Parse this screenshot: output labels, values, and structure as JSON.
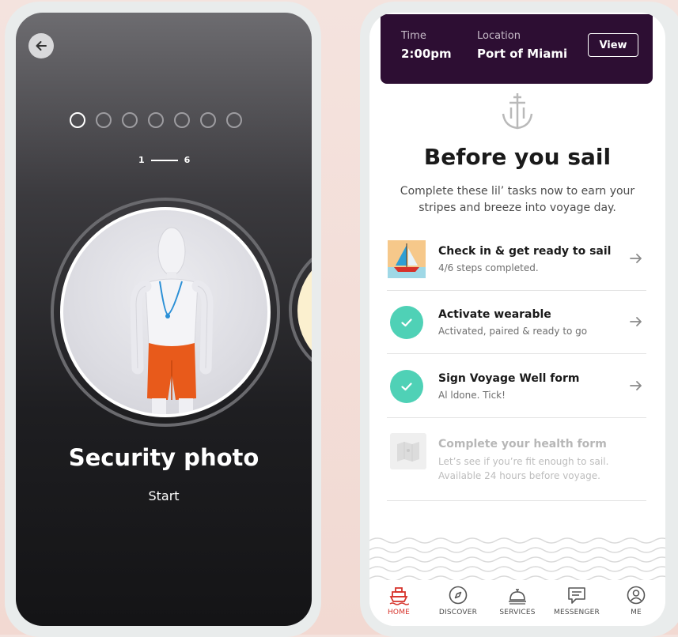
{
  "left_screen": {
    "progress": {
      "current": "1",
      "total": "6",
      "dot_count": 7,
      "active_index": 0
    },
    "card": {
      "title": "Security photo",
      "action": "Start"
    }
  },
  "right_screen": {
    "header": {
      "time_label": "Time",
      "time_value": "2:00pm",
      "location_label": "Location",
      "location_value": "Port of Miami",
      "view_button": "View"
    },
    "title": "Before you sail",
    "subtitle_line1": "Complete these lil’ tasks now to earn your",
    "subtitle_line2": "stripes and breeze into voyage day.",
    "tasks": [
      {
        "title": "Check in & get ready to sail",
        "subtitle": "4/6 steps completed.",
        "icon": "sailboat-icon",
        "state": "in-progress"
      },
      {
        "title": "Activate wearable",
        "subtitle": "Activated, paired & ready to go",
        "icon": "check-icon",
        "state": "done"
      },
      {
        "title": "Sign Voyage Well form",
        "subtitle": "Al ldone. Tick!",
        "icon": "check-icon",
        "state": "done"
      },
      {
        "title": "Complete your health form",
        "subtitle_line1": "Let’s see if you’re fit enough to sail.",
        "subtitle_line2": "Available 24 hours before voyage.",
        "icon": "map-icon",
        "state": "disabled"
      }
    ],
    "nav": {
      "home": "HOME",
      "discover": "DISCOVER",
      "services": "SERVICES",
      "messenger": "MESSENGER",
      "me": "ME"
    }
  },
  "colors": {
    "header_bg": "#2d0e33",
    "check_green": "#4fd1b6",
    "nav_active": "#d6322a",
    "card_bg": "#1e1e21"
  }
}
